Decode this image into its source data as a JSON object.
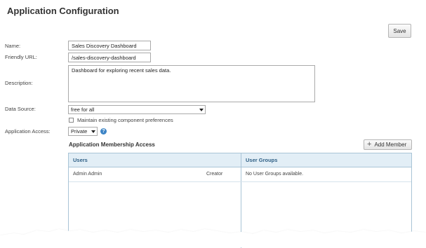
{
  "header": {
    "title": "Application Configuration",
    "save_label": "Save"
  },
  "form": {
    "name_label": "Name:",
    "name_value": "Sales Discovery Dashboard",
    "url_label": "Friendly URL:",
    "url_value": "/sales-discovery-dashboard",
    "description_label": "Description:",
    "description_value": "Dashboard for exploring recent sales data.",
    "datasource_label": "Data Source:",
    "datasource_value": "free for all",
    "maintain_label": "Maintain existing component preferences",
    "maintain_checked": false,
    "access_label": "Application Access:",
    "access_value": "Private",
    "help_glyph": "?"
  },
  "membership": {
    "title": "Application Membership Access",
    "add_label": "Add Member",
    "add_glyph": "+",
    "users_header": "Users",
    "groups_header": "User Groups",
    "users": [
      {
        "name": "Admin Admin",
        "role": "Creator"
      }
    ],
    "groups_empty": "No User Groups available."
  }
}
